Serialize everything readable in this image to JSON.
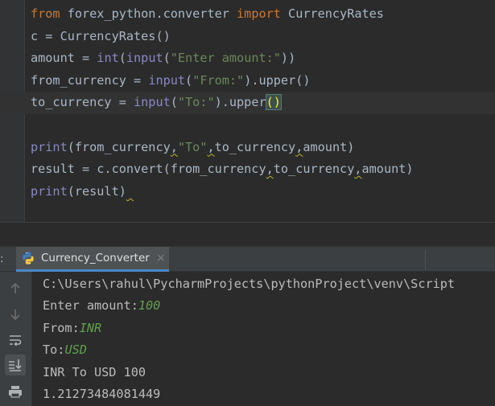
{
  "editor": {
    "lines": [
      [
        {
          "t": "from",
          "c": "kw"
        },
        {
          "t": " forex_python.converter ",
          "c": "plain"
        },
        {
          "t": "import",
          "c": "kw"
        },
        {
          "t": " CurrencyRates",
          "c": "plain"
        }
      ],
      [
        {
          "t": "c = CurrencyRates()",
          "c": "plain"
        }
      ],
      [
        {
          "t": "amount = ",
          "c": "plain"
        },
        {
          "t": "int",
          "c": "fn"
        },
        {
          "t": "(",
          "c": "plain"
        },
        {
          "t": "input",
          "c": "fn"
        },
        {
          "t": "(",
          "c": "plain"
        },
        {
          "t": "\"Enter amount:\"",
          "c": "str"
        },
        {
          "t": "))",
          "c": "plain"
        }
      ],
      [
        {
          "t": "from_currency = ",
          "c": "plain"
        },
        {
          "t": "input",
          "c": "fn"
        },
        {
          "t": "(",
          "c": "plain"
        },
        {
          "t": "\"From:\"",
          "c": "str"
        },
        {
          "t": ").upper()",
          "c": "plain"
        }
      ],
      [
        {
          "t": "to_currency = ",
          "c": "plain"
        },
        {
          "t": "input",
          "c": "fn"
        },
        {
          "t": "(",
          "c": "plain"
        },
        {
          "t": "\"To:\"",
          "c": "str"
        },
        {
          "t": ").upper",
          "c": "plain"
        },
        {
          "t": "()",
          "c": "bracket-hl"
        }
      ],
      [],
      [
        {
          "t": "print",
          "c": "fn"
        },
        {
          "t": "(from_currency",
          "c": "plain"
        },
        {
          "t": ",",
          "c": "plain warn"
        },
        {
          "t": "\"To\"",
          "c": "str"
        },
        {
          "t": ",",
          "c": "plain warn"
        },
        {
          "t": "to_currency",
          "c": "plain"
        },
        {
          "t": ",",
          "c": "plain warn"
        },
        {
          "t": "amount)",
          "c": "plain"
        }
      ],
      [
        {
          "t": "result = c.convert(from_currency",
          "c": "plain"
        },
        {
          "t": ",",
          "c": "plain warn"
        },
        {
          "t": "to_currency",
          "c": "plain"
        },
        {
          "t": ",",
          "c": "plain warn"
        },
        {
          "t": "amount)",
          "c": "plain"
        }
      ],
      [
        {
          "t": "print",
          "c": "fn"
        },
        {
          "t": "(result)",
          "c": "plain"
        },
        {
          "t": " ",
          "c": "plain warn"
        }
      ]
    ],
    "current_line": 4
  },
  "run_panel": {
    "prefix": ":",
    "tab_label": "Currency_Converter",
    "close_glyph": "×"
  },
  "console": {
    "lines": [
      [
        {
          "t": "C:\\Users\\rahul\\PycharmProjects\\pythonProject\\venv\\Script",
          "c": ""
        }
      ],
      [
        {
          "t": "Enter amount:",
          "c": ""
        },
        {
          "t": "100",
          "c": "input-echo"
        }
      ],
      [
        {
          "t": "From:",
          "c": ""
        },
        {
          "t": "INR",
          "c": "input-echo"
        }
      ],
      [
        {
          "t": "To:",
          "c": ""
        },
        {
          "t": "USD",
          "c": "input-echo"
        }
      ],
      [
        {
          "t": "INR To USD 100",
          "c": ""
        }
      ],
      [
        {
          "t": "1.21273484081449",
          "c": ""
        }
      ]
    ]
  },
  "toolbar": {
    "buttons": [
      {
        "name": "scroll-up-icon",
        "active": false
      },
      {
        "name": "scroll-down-icon",
        "active": false
      },
      {
        "name": "soft-wrap-icon",
        "active": false
      },
      {
        "name": "scroll-to-end-icon",
        "active": true
      },
      {
        "name": "print-icon",
        "active": false
      }
    ]
  },
  "colors": {
    "keyword": "#cc7832",
    "builtin": "#8888c6",
    "string": "#6a8759",
    "text": "#a9b7c6",
    "input_echo": "#5fa34a",
    "tab_accent": "#4a88c7"
  }
}
